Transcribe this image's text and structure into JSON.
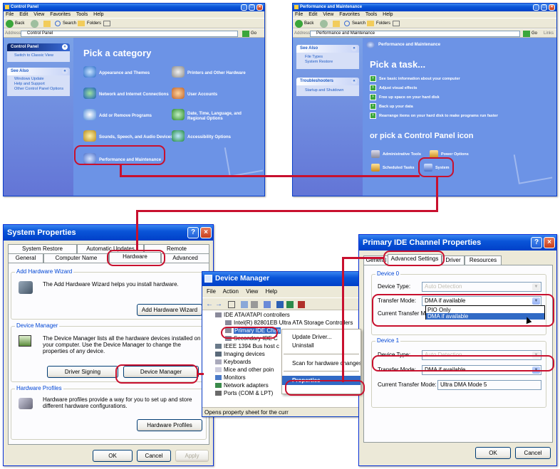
{
  "control_panel": {
    "title": "Control Panel",
    "menu": [
      "File",
      "Edit",
      "View",
      "Favorites",
      "Tools",
      "Help"
    ],
    "toolbar": {
      "back": "Back",
      "search": "Search",
      "folders": "Folders"
    },
    "address_label": "Address",
    "address": "Control Panel",
    "go": "Go",
    "side_panel": {
      "header": "Control Panel",
      "switch_view": "Switch to Classic View",
      "see_also_header": "See Also",
      "see_also": [
        "Windows Update",
        "Help and Support",
        "Other Control Panel Options"
      ]
    },
    "heading": "Pick a category",
    "categories": [
      "Appearance and Themes",
      "Printers and Other Hardware",
      "Network and Internet Connections",
      "User Accounts",
      "Add or Remove Programs",
      "Date, Time, Language, and Regional Options",
      "Sounds, Speech, and Audio Devices",
      "Accessibility Options",
      "Performance and Maintenance"
    ]
  },
  "perf": {
    "title": "Performance and Maintenance",
    "menu": [
      "File",
      "Edit",
      "View",
      "Favorites",
      "Tools",
      "Help"
    ],
    "toolbar": {
      "back": "Back",
      "search": "Search",
      "folders": "Folders"
    },
    "address_label": "Address",
    "address": "Performance and Maintenance",
    "go": "Go",
    "links": "Links",
    "see_also_header": "See Also",
    "see_also": [
      "File Types",
      "System Restore"
    ],
    "troubleshooters_header": "Troubleshooters",
    "troubleshooters": [
      "Startup and Shutdown"
    ],
    "banner": "Performance and Maintenance",
    "pick_task": "Pick a task...",
    "tasks": [
      "See basic information about your computer",
      "Adjust visual effects",
      "Free up space on your hard disk",
      "Back up your data",
      "Rearrange items on your hard disk to make programs run faster"
    ],
    "or_pick": "or pick a Control Panel icon",
    "icons": [
      "Administrative Tools",
      "Power Options",
      "Scheduled Tasks",
      "System"
    ]
  },
  "sysprops": {
    "title": "System Properties",
    "help": "?",
    "tabs_top": [
      "System Restore",
      "Automatic Updates",
      "Remote"
    ],
    "tabs_bottom": [
      "General",
      "Computer Name",
      "Hardware",
      "Advanced"
    ],
    "wizard_group": "Add Hardware Wizard",
    "wizard_text": "The Add Hardware Wizard helps you install hardware.",
    "wizard_button": "Add Hardware Wizard",
    "devmgr_group": "Device Manager",
    "devmgr_text": "The Device Manager lists all the hardware devices installed on your computer. Use the Device Manager to change the properties of any device.",
    "driver_signing": "Driver Signing",
    "device_manager": "Device Manager",
    "profiles_group": "Hardware Profiles",
    "profiles_text": "Hardware profiles provide a way for you to set up and store different hardware configurations.",
    "profiles_button": "Hardware Profiles",
    "ok": "OK",
    "cancel": "Cancel",
    "apply": "Apply"
  },
  "devmgr": {
    "title": "Device Manager",
    "menu": [
      "File",
      "Action",
      "View",
      "Help"
    ],
    "tree": [
      "IDE ATA/ATAPI controllers",
      "Intel(R) 82801EB Ultra ATA Storage Controllers",
      "Primary IDE Chan",
      "Secondary IDE C",
      "IEEE 1394 Bus host c",
      "Imaging devices",
      "Keyboards",
      "Mice and other poin",
      "Monitors",
      "Network adapters",
      "Ports (COM & LPT)"
    ],
    "context_menu": [
      "Update Driver...",
      "Uninstall",
      "Scan for hardware changes",
      "Properties"
    ],
    "status": "Opens property sheet for the curr"
  },
  "ide": {
    "title": "Primary IDE Channel Properties",
    "help": "?",
    "tabs": [
      "General",
      "Advanced Settings",
      "Driver",
      "Resources"
    ],
    "device0": "Device 0",
    "device_type_label": "Device Type:",
    "device_type_value": "Auto Detection",
    "transfer_mode_label": "Transfer Mode:",
    "transfer_mode_value": "DMA if available",
    "current_mode_label": "Current Transfer M",
    "dropdown_options": [
      "PIO Only",
      "DMA if available"
    ],
    "device1": "Device 1",
    "device1_type_value": "Auto Detection",
    "device1_mode_value": "DMA if available",
    "current_mode_label_full": "Current Transfer Mode:",
    "current_mode_value": "Ultra DMA Mode 5",
    "ok": "OK",
    "cancel": "Cancel"
  },
  "colors": {
    "highlight": "#c8102e",
    "xp_blue": "#0a55d8",
    "panel_blue": "#6c93e6"
  }
}
